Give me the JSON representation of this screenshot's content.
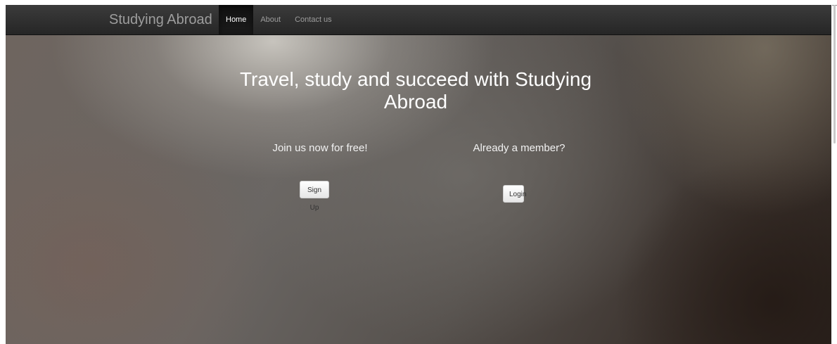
{
  "navbar": {
    "brand": "Studying Abroad",
    "items": [
      {
        "label": "Home",
        "active": true
      },
      {
        "label": "About",
        "active": false
      },
      {
        "label": "Contact us",
        "active": false
      }
    ]
  },
  "hero": {
    "title": "Travel, study and succeed with Studying Abroad",
    "join": {
      "text": "Join us now for free!",
      "button_label": "Sign Up"
    },
    "member": {
      "text": "Already a member?",
      "button_label": "Login"
    }
  },
  "colors": {
    "navbar_bg": "#262626",
    "nav_text": "#9d9d9d",
    "nav_active_text": "#ffffff",
    "hero_text": "#ffffff"
  }
}
